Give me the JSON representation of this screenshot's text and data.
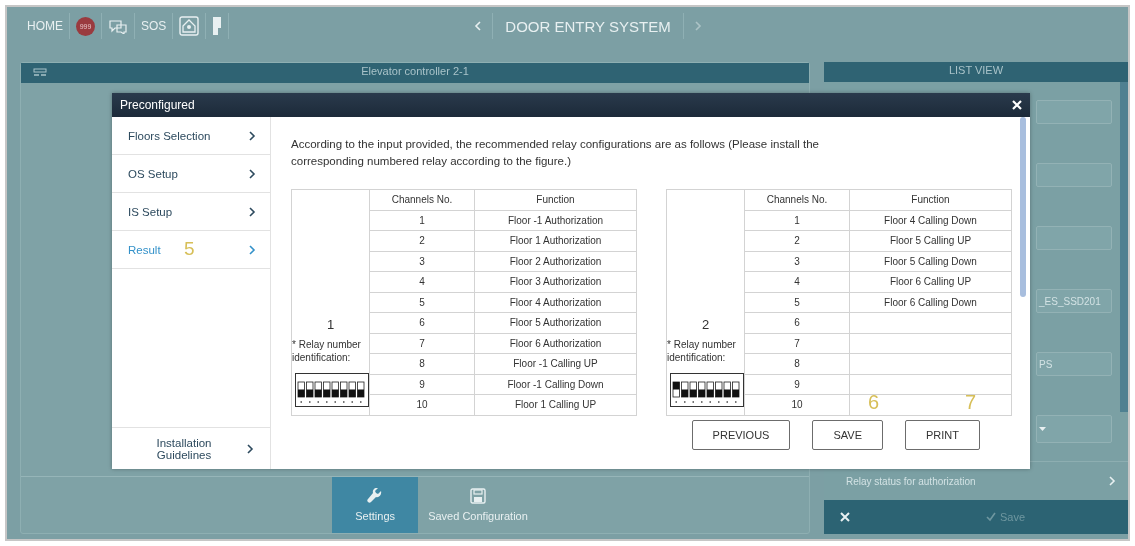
{
  "top_bar": {
    "items": [
      {
        "kind": "text",
        "label": "HOME"
      },
      {
        "kind": "badge",
        "label": "999"
      },
      {
        "kind": "chat"
      },
      {
        "kind": "text",
        "label": "SOS"
      },
      {
        "kind": "house"
      },
      {
        "kind": "door"
      }
    ],
    "title": "DOOR ENTRY SYSTEM",
    "prev_enabled": true,
    "next_enabled": false
  },
  "main_panel": {
    "title": "Elevator controller 2-1",
    "tabs": [
      {
        "kind": "wrench",
        "label": "Settings",
        "selected": true
      },
      {
        "kind": "floppy",
        "label": "Saved Configuration",
        "selected": false
      }
    ]
  },
  "list_panel": {
    "title": "LIST VIEW",
    "fields": [
      {
        "kind": "input"
      },
      {
        "kind": "input"
      },
      {
        "kind": "input"
      },
      {
        "kind": "input",
        "value": "_ES_SSD201"
      },
      {
        "kind": "input",
        "value": "PS"
      },
      {
        "kind": "select"
      }
    ],
    "row_label": "Relay status for authorization",
    "save_label": "Save",
    "save_disabled": true
  },
  "modal": {
    "title": "Preconfigured",
    "nav": [
      {
        "label": "Floors Selection",
        "selected": false
      },
      {
        "label": "OS Setup",
        "selected": false
      },
      {
        "label": "IS Setup",
        "selected": false
      },
      {
        "label": "Result",
        "selected": true,
        "annotation": "5"
      }
    ],
    "nav_footer": "Installation Guidelines",
    "intro": "According to the input provided, the recommended relay configurations are as follows (Please install the corresponding numbered relay according to the figure.)",
    "relays": [
      {
        "number": "1",
        "caption": "* Relay number identification:",
        "columns": [
          "Channels No.",
          "Function"
        ],
        "dip": {
          "switches": [
            {
              "on": false
            },
            {
              "on": false
            },
            {
              "on": false
            },
            {
              "on": false
            },
            {
              "on": false
            },
            {
              "on": false
            },
            {
              "on": false
            },
            {
              "on": false
            }
          ]
        },
        "rows": [
          {
            "channel": "1",
            "function": "Floor -1 Authorization"
          },
          {
            "channel": "2",
            "function": "Floor 1 Authorization"
          },
          {
            "channel": "3",
            "function": "Floor 2 Authorization"
          },
          {
            "channel": "4",
            "function": "Floor 3 Authorization"
          },
          {
            "channel": "5",
            "function": "Floor 4 Authorization"
          },
          {
            "channel": "6",
            "function": "Floor 5 Authorization"
          },
          {
            "channel": "7",
            "function": "Floor 6 Authorization"
          },
          {
            "channel": "8",
            "function": "Floor -1 Calling UP"
          },
          {
            "channel": "9",
            "function": "Floor -1 Calling Down"
          },
          {
            "channel": "10",
            "function": "Floor 1 Calling UP"
          }
        ]
      },
      {
        "number": "2",
        "caption": "* Relay number identification:",
        "columns": [
          "Channels No.",
          "Function"
        ],
        "dip": {
          "switches": [
            {
              "on": true
            },
            {
              "on": false
            },
            {
              "on": false
            },
            {
              "on": false
            },
            {
              "on": false
            },
            {
              "on": false
            },
            {
              "on": false
            },
            {
              "on": false
            }
          ]
        },
        "rows": [
          {
            "channel": "1",
            "function": "Floor 4 Calling Down"
          },
          {
            "channel": "2",
            "function": "Floor 5 Calling UP"
          },
          {
            "channel": "3",
            "function": "Floor 5 Calling Down"
          },
          {
            "channel": "4",
            "function": "Floor 6 Calling UP"
          },
          {
            "channel": "5",
            "function": "Floor 6 Calling Down"
          },
          {
            "channel": "6"
          },
          {
            "channel": "7"
          },
          {
            "channel": "8"
          },
          {
            "channel": "9"
          },
          {
            "channel": "10"
          }
        ]
      }
    ],
    "buttons": [
      {
        "label": "PREVIOUS"
      },
      {
        "label": "SAVE",
        "annotation": "6"
      },
      {
        "label": "PRINT",
        "annotation": "7"
      }
    ]
  }
}
